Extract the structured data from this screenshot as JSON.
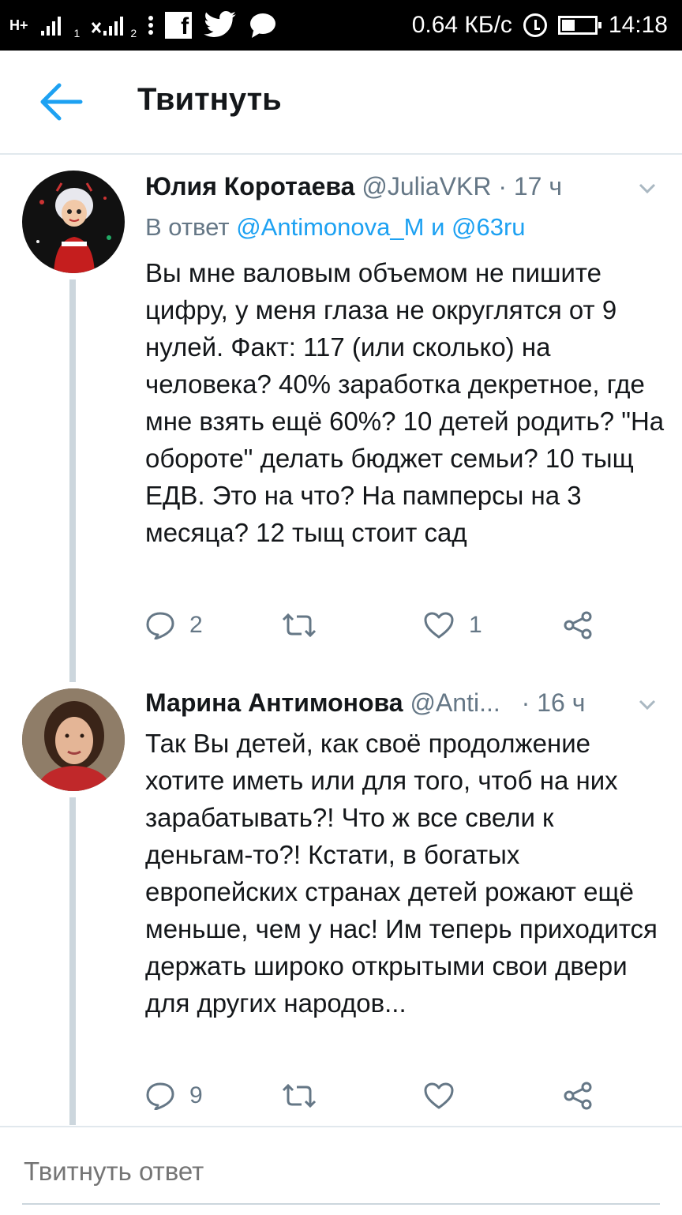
{
  "status_bar": {
    "network_type": "H+",
    "sim1_label": "1",
    "sim2_label": "2",
    "facebook_glyph": "f",
    "speed": "0.64 КБ/с",
    "time": "14:18",
    "icons": [
      "signal-icon",
      "facebook-icon",
      "twitter-icon",
      "messenger-icon",
      "alarm-icon",
      "battery-icon"
    ]
  },
  "header": {
    "title": "Твитнуть",
    "accent_color": "#1da1f2"
  },
  "tweets": [
    {
      "name": "Юлия Коротаева",
      "handle": "@JuliaVKR",
      "time": "· 17 ч",
      "reply_prefix": "В ответ",
      "reply_mention_1": "@Antimonova_M",
      "reply_and": "и",
      "reply_mention_2": "@63ru",
      "text": "Вы мне валовым объемом не пишите цифру, у меня глаза не округлятся от 9 нулей. Факт: 117 (или сколько) на человека? 40% заработка декретное, где мне взять ещё 60%? 10 детей родить? \"На обороте\" делать бюджет семьи? 10 тыщ ЕДВ. Это на что? На памперсы на 3 месяца? 12 тыщ стоит сад",
      "replies": "2",
      "retweets": "",
      "likes": "1"
    },
    {
      "name": "Марина Антимонова",
      "handle": "@Anti...",
      "time": "· 16 ч",
      "text": "Так Вы детей, как своё продолжение хотите иметь или для того, чтоб на них зарабатывать?! Что ж все свели к деньгам-то?! Кстати, в богатых европейских странах детей рожают ещё меньше, чем у нас! Им теперь приходится держать широко открытыми свои двери для других народов...",
      "replies": "9",
      "retweets": "",
      "likes": ""
    }
  ],
  "reply_bar": {
    "placeholder": "Твитнуть ответ"
  }
}
